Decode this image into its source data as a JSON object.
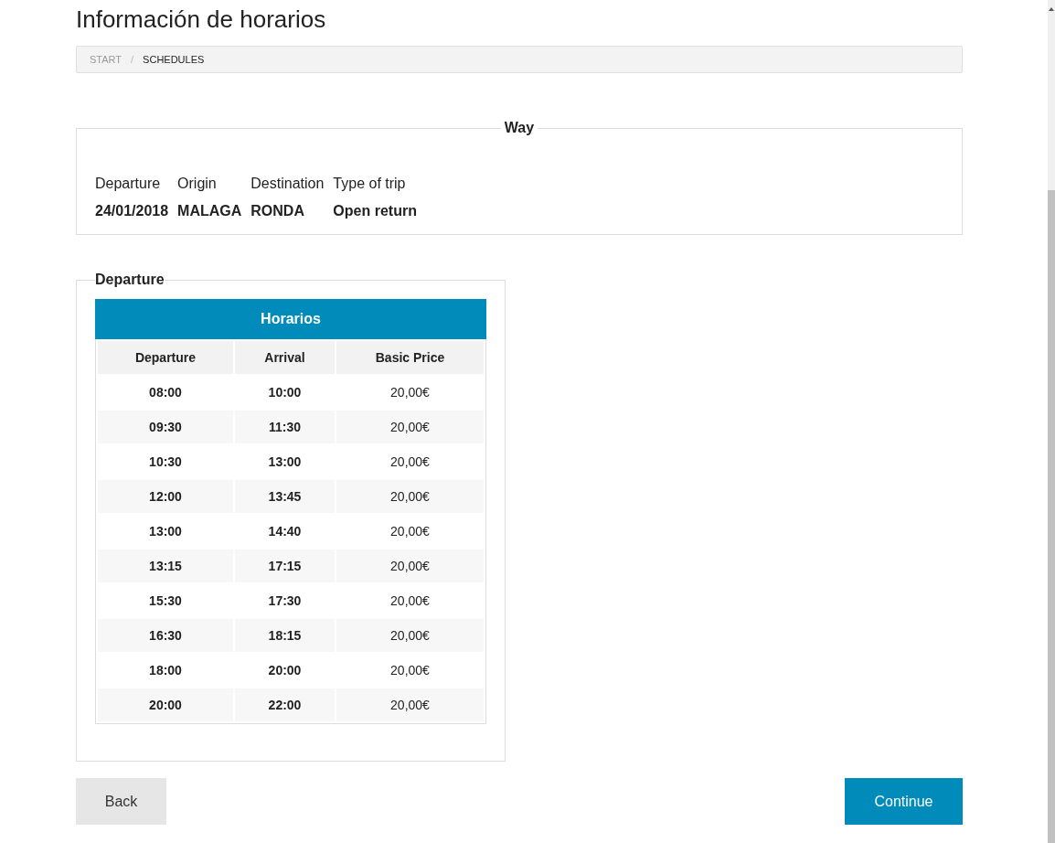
{
  "title": "Información de horarios",
  "breadcrumb": [
    {
      "label": "START",
      "current": false
    },
    {
      "label": "SCHEDULES",
      "current": true
    }
  ],
  "breadcrumb_separator": "/",
  "way": {
    "legend": "Way",
    "columns": [
      {
        "label": "Departure",
        "value": "24/01/2018"
      },
      {
        "label": "Origin",
        "value": "MALAGA"
      },
      {
        "label": "Destination",
        "value": "RONDA"
      },
      {
        "label": "Type of trip",
        "value": "Open return"
      }
    ]
  },
  "departure": {
    "legend": "Departure",
    "table": {
      "title": "Horarios",
      "columns": [
        "Departure",
        "Arrival",
        "Basic Price"
      ],
      "rows": [
        [
          "08:00",
          "10:00",
          "20,00€"
        ],
        [
          "09:30",
          "11:30",
          "20,00€"
        ],
        [
          "10:30",
          "13:00",
          "20,00€"
        ],
        [
          "12:00",
          "13:45",
          "20,00€"
        ],
        [
          "13:00",
          "14:40",
          "20,00€"
        ],
        [
          "13:15",
          "17:15",
          "20,00€"
        ],
        [
          "15:30",
          "17:30",
          "20,00€"
        ],
        [
          "16:30",
          "18:15",
          "20,00€"
        ],
        [
          "18:00",
          "20:00",
          "20,00€"
        ],
        [
          "20:00",
          "22:00",
          "20,00€"
        ]
      ]
    }
  },
  "buttons": {
    "back": "Back",
    "continue": "Continue"
  }
}
